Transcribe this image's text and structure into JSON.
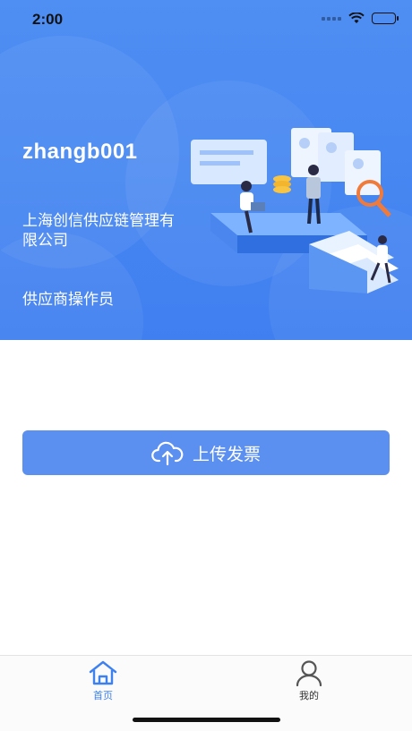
{
  "status_bar": {
    "time": "2:00"
  },
  "profile": {
    "username": "zhangb001",
    "company": "上海创信供应链管理有限公司",
    "role": "供应商操作员"
  },
  "actions": {
    "upload_label": "上传发票",
    "upload_icon": "cloud-upload-icon"
  },
  "tabbar": {
    "items": [
      {
        "label": "首页",
        "icon": "home-icon",
        "active": true
      },
      {
        "label": "我的",
        "icon": "person-icon",
        "active": false
      }
    ]
  },
  "colors": {
    "primary": "#3d80ef",
    "button": "#5b8ff0"
  }
}
